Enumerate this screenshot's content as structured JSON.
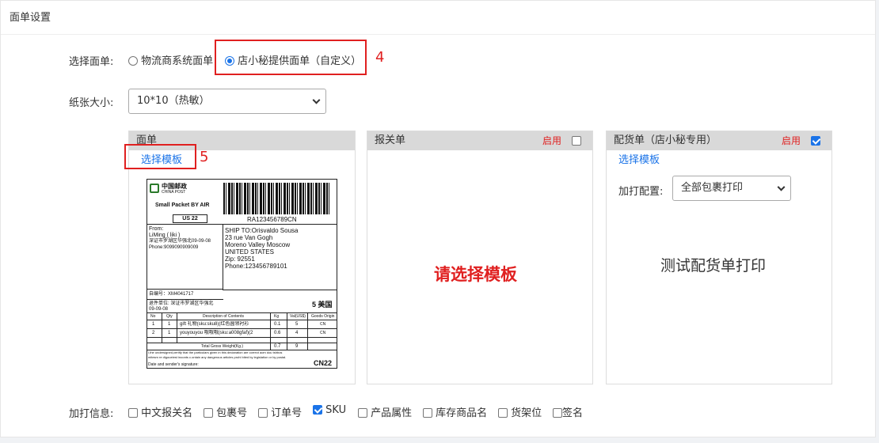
{
  "panel": {
    "title": "面单设置"
  },
  "select_waybill": {
    "label": "选择面单:",
    "options": [
      "物流商系统面单",
      "店小秘提供面单（自定义）"
    ],
    "selected_index": 1,
    "annotation": "4"
  },
  "paper_size": {
    "label": "纸张大小:",
    "value": "10*10（热敏）"
  },
  "cards": {
    "waybill": {
      "title": "面单",
      "choose_template": "选择模板",
      "annotation": "5",
      "preview": {
        "brand_cn": "中国邮政",
        "brand_en": "CHINA POST",
        "service": "Small Packet BY AIR",
        "country_code": "US 22",
        "tracking": "RA123456789CN",
        "from_label": "From:",
        "from_name": "LiMing ( liki )",
        "from_addr": "深证市罗湖区华强北09-09-08",
        "from_phone": "Phone:9099090909009",
        "ship_to": "SHIP TO:Orisvaldo Sousa",
        "to_line1": "23 rue Van Gogh",
        "to_line2": "Moreno Valley Moscow",
        "to_line3": "UNITED STATES",
        "to_zip": "Zip: 92551",
        "to_phone": "Phone:123456789101",
        "self_no": "自编号：XM4041717",
        "return_unit": "退件单位: 深证市罗湖区华强北",
        "return_unit2": "09-09-08",
        "zone": "5 美国",
        "col_no": "No",
        "col_qty": "Qty",
        "col_desc": "Description of Contents",
        "col_kg": "Kg",
        "col_val": "Val(US$)",
        "col_origin": "Goods Origin",
        "rows": [
          {
            "no": "1",
            "qty": "1",
            "desc": "gift  礼物(sku:sku8)(红色圆领衬衫",
            "kg": "0.1",
            "val": "5",
            "origin": "CN"
          },
          {
            "no": "2",
            "qty": "1",
            "desc": "youyouyou  哦哦哦(sku:a008gfaf)(2",
            "kg": "0.6",
            "val": "4",
            "origin": "CN"
          }
        ],
        "total_label": "Total Gross Weight(Kg.)",
        "total_kg": "0.7",
        "total_val": "9",
        "declaration": "I,the undersigned,certify that the particulars given in this declaration are correct aom dou tshbos",
        "declaration2": "mitesm re digoueiest inoonts c.ontain any dangerous articles prohi bited by legislation or by postal.",
        "signature": "Date and sender's signature:",
        "cn22": "CN22"
      }
    },
    "customs": {
      "title": "报关单",
      "enable_label": "启用",
      "enabled": false,
      "placeholder": "请选择模板"
    },
    "picking": {
      "title": "配货单（店小秘专用）",
      "enable_label": "启用",
      "enabled": true,
      "choose_template": "选择模板",
      "extra_config_label": "加打配置:",
      "extra_config_value": "全部包裹打印",
      "test_print": "测试配货单打印"
    }
  },
  "extra_info": {
    "label": "加打信息:",
    "options": [
      {
        "label": "中文报关名",
        "checked": false
      },
      {
        "label": "包裹号",
        "checked": false
      },
      {
        "label": "订单号",
        "checked": false
      },
      {
        "label": "SKU",
        "checked": true
      },
      {
        "label": "产品属性",
        "checked": false
      },
      {
        "label": "库存商品名",
        "checked": false
      },
      {
        "label": "货架位",
        "checked": false
      },
      {
        "label": "签名",
        "checked": false
      }
    ]
  },
  "colors": {
    "accent": "#1a73e8",
    "annotation": "#e02020",
    "card_header": "#d9d9d9"
  }
}
